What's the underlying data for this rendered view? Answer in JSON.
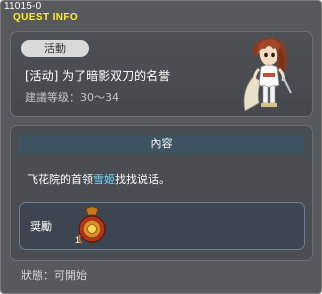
{
  "window": {
    "id": "11015-0",
    "title": "QUEST INFO"
  },
  "quest": {
    "category": "活動",
    "title": "[活动] 为了暗影双刀的名誉",
    "level": "建議等级：30～34",
    "npc_portrait_icon": "npc-portrait-swordswoman"
  },
  "content": {
    "header": "內容",
    "text_before": "飞花院的首领",
    "npc_name": "雪姬",
    "text_after": "找找说话。"
  },
  "reward": {
    "label": "奨勵",
    "item_icon": "reward-medal-icon",
    "item_count": "1"
  },
  "status": {
    "text": "狀態：可開始"
  },
  "colors": {
    "title": "#ffee2e",
    "npc_link": "#6bd6ff",
    "header_bar": "#3d5360",
    "window_bg": "#575a5d"
  }
}
